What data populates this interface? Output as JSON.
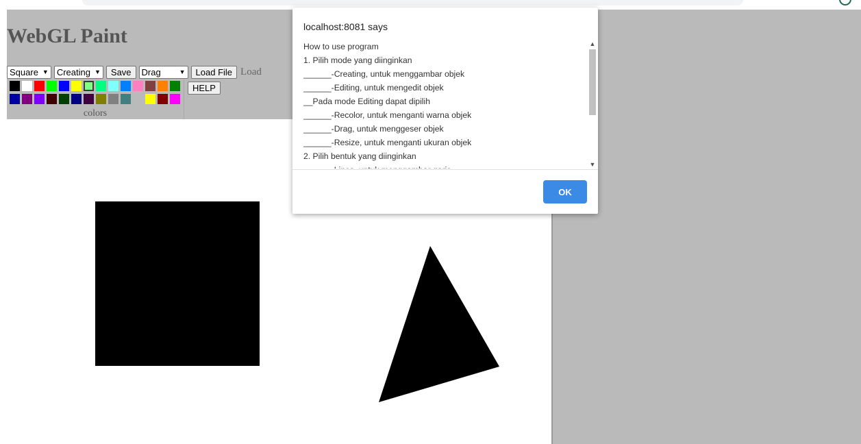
{
  "app": {
    "title": "WebGL Paint"
  },
  "toolbar": {
    "shape_select": "Square",
    "mode_select": "Creating",
    "save_label": "Save",
    "edit_select": "Drag",
    "load_file_label": "Load File",
    "load_text": "Load",
    "help_label": "HELP"
  },
  "palette": {
    "label": "colors",
    "row1": [
      "#000000",
      "#ffffff",
      "#ff0000",
      "#00ff00",
      "#0000ff",
      "#ffff00",
      "#80ff80",
      "#00ff80",
      "#80ffff",
      "#0080ff",
      "#ff80c0",
      "#804040",
      "#ff8000",
      "#008000"
    ],
    "row2": [
      "#0000a0",
      "#800080",
      "#8000ff",
      "#400000",
      "#004000",
      "#000080",
      "#400040",
      "#808000",
      "#808080",
      "#408080",
      "#bababa",
      "#ffff00",
      "#800000",
      "#ff00ff"
    ],
    "selected_color": "#80ff80"
  },
  "canvas": {
    "shapes": [
      {
        "type": "square",
        "fill": "#000000"
      },
      {
        "type": "triangle",
        "fill": "#000000"
      }
    ]
  },
  "dialog": {
    "title": "localhost:8081 says",
    "lines": [
      "How to use program",
      "1. Pilih mode yang diinginkan",
      "______-Creating, untuk menggambar objek",
      "______-Editing, untuk mengedit objek",
      "__Pada mode Editing dapat dipilih",
      "______-Recolor, untuk menganti warna objek",
      "______-Drag, untuk menggeser objek",
      "______-Resize, untuk menganti ukuran objek",
      "2. Pilih bentuk yang diinginkan",
      "______-Lines, untuk menggambar garis"
    ],
    "ok_label": "OK"
  }
}
